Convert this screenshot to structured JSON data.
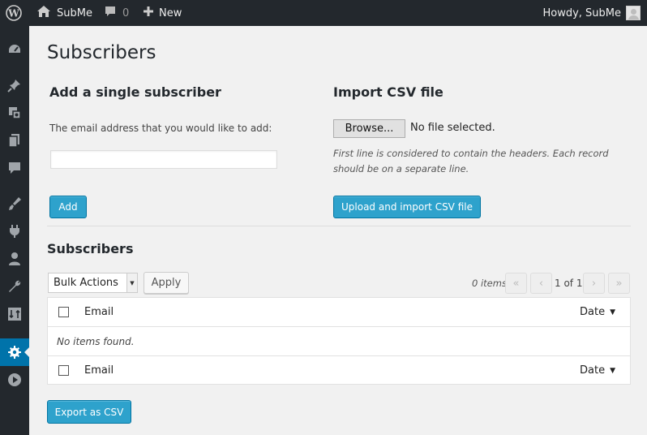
{
  "adminbar": {
    "site_name": "SubMe",
    "comments_count": "0",
    "new_label": "New",
    "howdy": "Howdy, SubMe"
  },
  "sidebar": {
    "icons": [
      "dashboard-icon",
      "pin-icon",
      "media-icon",
      "pages-icon",
      "comments-icon",
      "appearance-icon",
      "plugins-icon",
      "users-icon",
      "tools-icon",
      "import-export-icon",
      "settings-icon",
      "play-icon"
    ],
    "active": "settings-icon"
  },
  "page": {
    "title": "Subscribers"
  },
  "add_single": {
    "heading": "Add a single subscriber",
    "description": "The email address that you would like to add:",
    "email_value": "",
    "add_label": "Add"
  },
  "import_csv": {
    "heading": "Import CSV file",
    "browse_label": "Browse...",
    "no_file": "No file selected.",
    "note": "First line is considered to contain the headers. Each record should be on a separate line.",
    "upload_label": "Upload and import CSV file"
  },
  "subscribers": {
    "heading": "Subscribers",
    "bulk_selected": "Bulk Actions",
    "apply_label": "Apply",
    "items_count": "0 items",
    "pagination": {
      "first": "«",
      "prev": "‹",
      "current": "1 of 1",
      "next": "›",
      "last": "»"
    },
    "columns": {
      "email": "Email",
      "date": "Date"
    },
    "empty_text": "No items found.",
    "export_label": "Export as CSV"
  },
  "colors": {
    "primary": "#2ea2cc",
    "adminbar": "#23282d",
    "active_menu": "#0073aa"
  }
}
